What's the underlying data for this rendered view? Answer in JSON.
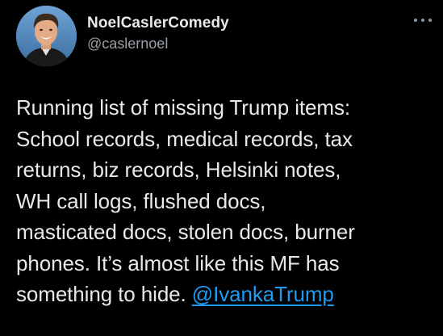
{
  "author": {
    "display_name": "NoelCaslerComedy",
    "handle": "@caslernoel"
  },
  "tweet": {
    "lines": [
      "Running list of missing Trump items:",
      "School records, medical records, tax",
      "returns, biz records, Helsinki notes,",
      "WH call logs, flushed docs,",
      "masticated docs, stolen docs, burner",
      "phones. It’s almost like this MF has",
      "something to hide."
    ],
    "mention": "@IvankaTrump"
  },
  "icons": {
    "more": "more-options-icon"
  },
  "colors": {
    "background": "#000000",
    "text": "#e7e9ea",
    "secondary": "#9aa0a6",
    "link": "#1d9bf0"
  }
}
